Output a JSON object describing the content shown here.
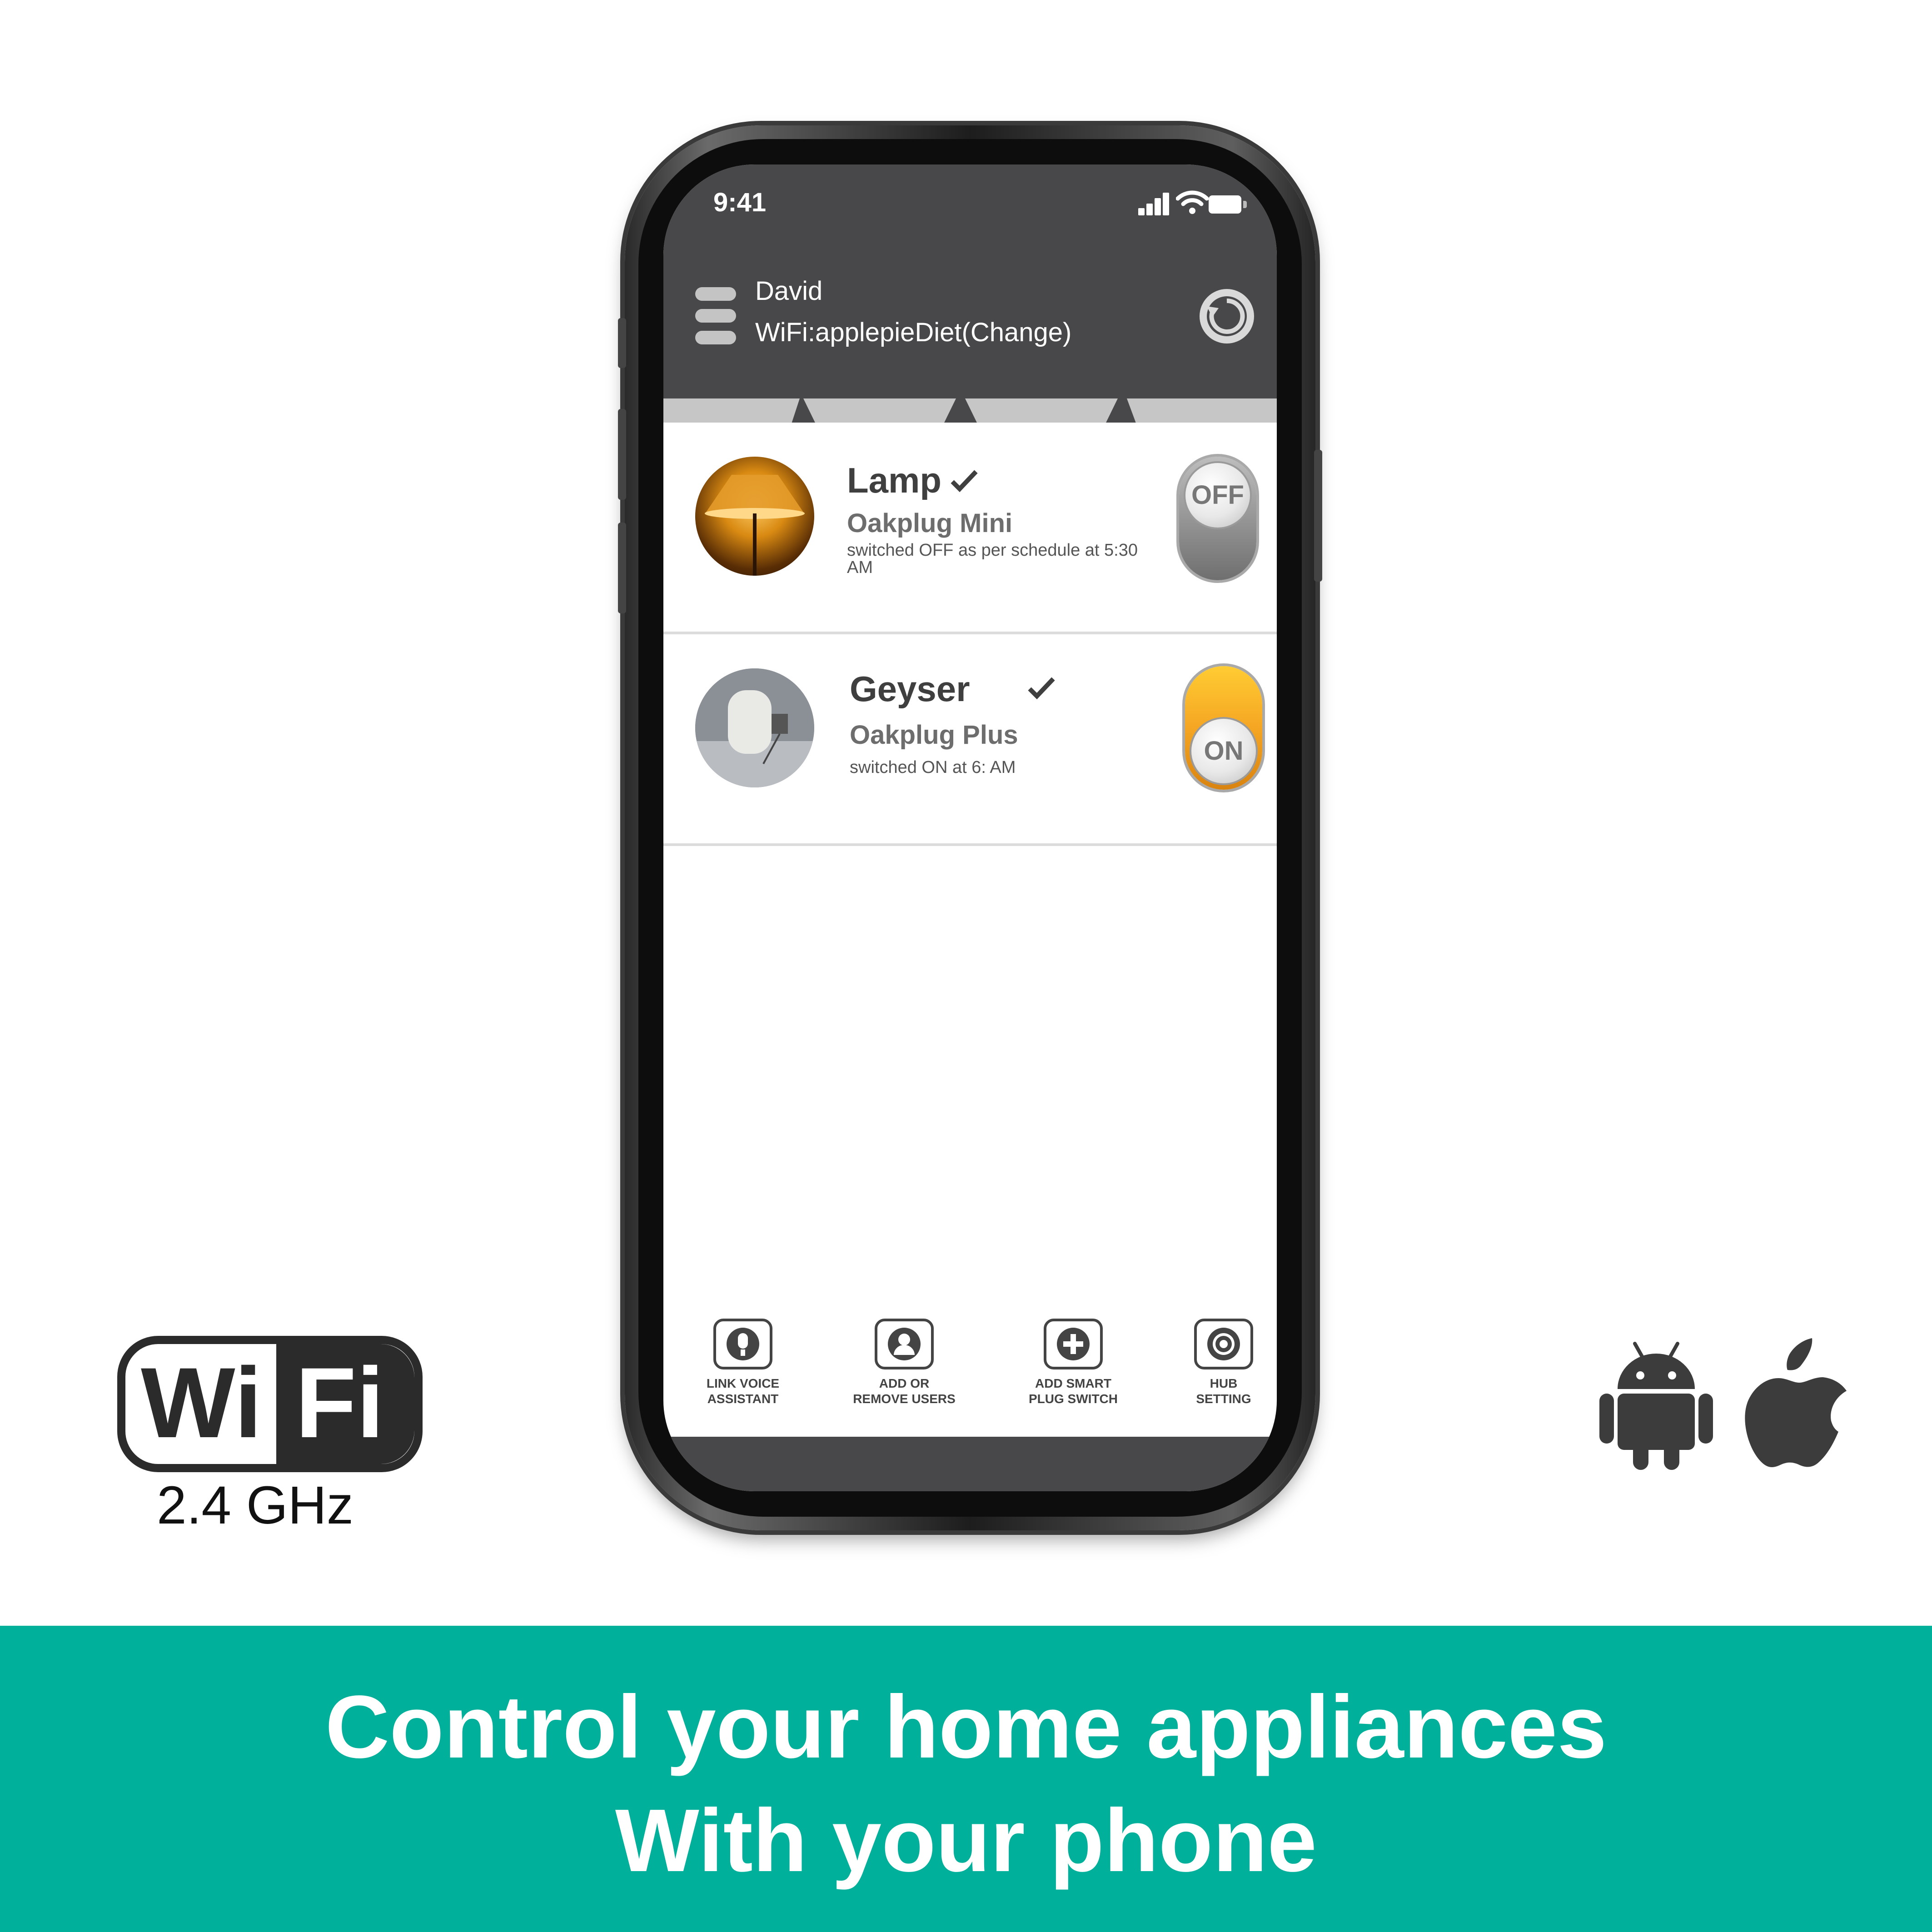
{
  "status_bar": {
    "time": "9:41"
  },
  "header": {
    "user_name": "David",
    "wifi_text": "WiFi:applepieDiet(Change)"
  },
  "devices": [
    {
      "name": "Lamp",
      "model": "Oakplug Mini",
      "status": "switched OFF as per schedule at 5:30 AM",
      "toggle": "OFF",
      "icon": "lamp-photo"
    },
    {
      "name": "Geyser",
      "model": "Oakplug Plus",
      "status": "switched ON at 6: AM",
      "toggle": "ON",
      "icon": "geyser-photo"
    }
  ],
  "bottom_nav": [
    {
      "label": "LINK VOICE\nASSISTANT",
      "icon": "voice-assistant-icon"
    },
    {
      "label": "ADD OR\nREMOVE USERS",
      "icon": "user-icon"
    },
    {
      "label": "ADD SMART\nPLUG SWITCH",
      "icon": "plus-icon"
    },
    {
      "label": "HUB\nSETTING",
      "icon": "gear-icon"
    }
  ],
  "badges": {
    "wifi_logo_left": "Wi",
    "wifi_logo_right": "Fi",
    "wifi_frequency": "2.4 GHz"
  },
  "banner": {
    "line1": "Control your home appliances",
    "line2": "With your phone"
  },
  "colors": {
    "accent": "#00b09b",
    "header": "#48484a",
    "toggle_on": "#f5a623",
    "toggle_off": "#8a8a8a"
  }
}
